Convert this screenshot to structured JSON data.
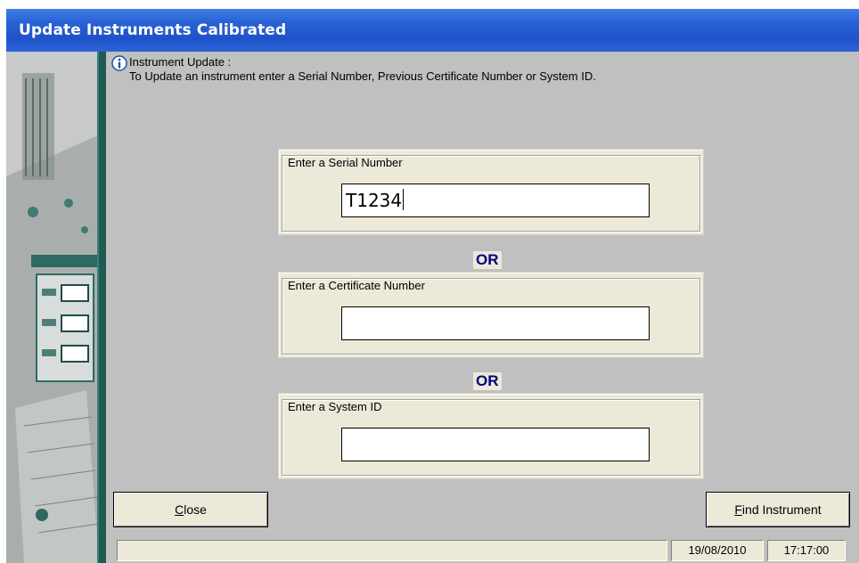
{
  "window": {
    "title": "Update Instruments Calibrated"
  },
  "info": {
    "heading": "Instrument Update :",
    "text": "To Update an instrument enter a Serial Number, Previous Certificate Number or System ID."
  },
  "serial": {
    "legend": "Enter a Serial Number",
    "value": "T1234"
  },
  "or_label": "OR",
  "certificate": {
    "legend": "Enter a Certificate Number",
    "value": ""
  },
  "system": {
    "legend": "Enter a System ID",
    "value": ""
  },
  "buttons": {
    "close": {
      "accel": "C",
      "rest": "lose"
    },
    "find": {
      "accel": "F",
      "rest": "ind Instrument"
    }
  },
  "status": {
    "message": "",
    "date": "19/08/2010",
    "time": "17:17:00"
  },
  "icons": {
    "info": "info-icon",
    "decorative": "instrument-panel-art"
  },
  "colors": {
    "titlebar": "#2a63d6",
    "or_text": "#000080",
    "client": "#c0c0c0",
    "panel": "#ece9d8"
  }
}
